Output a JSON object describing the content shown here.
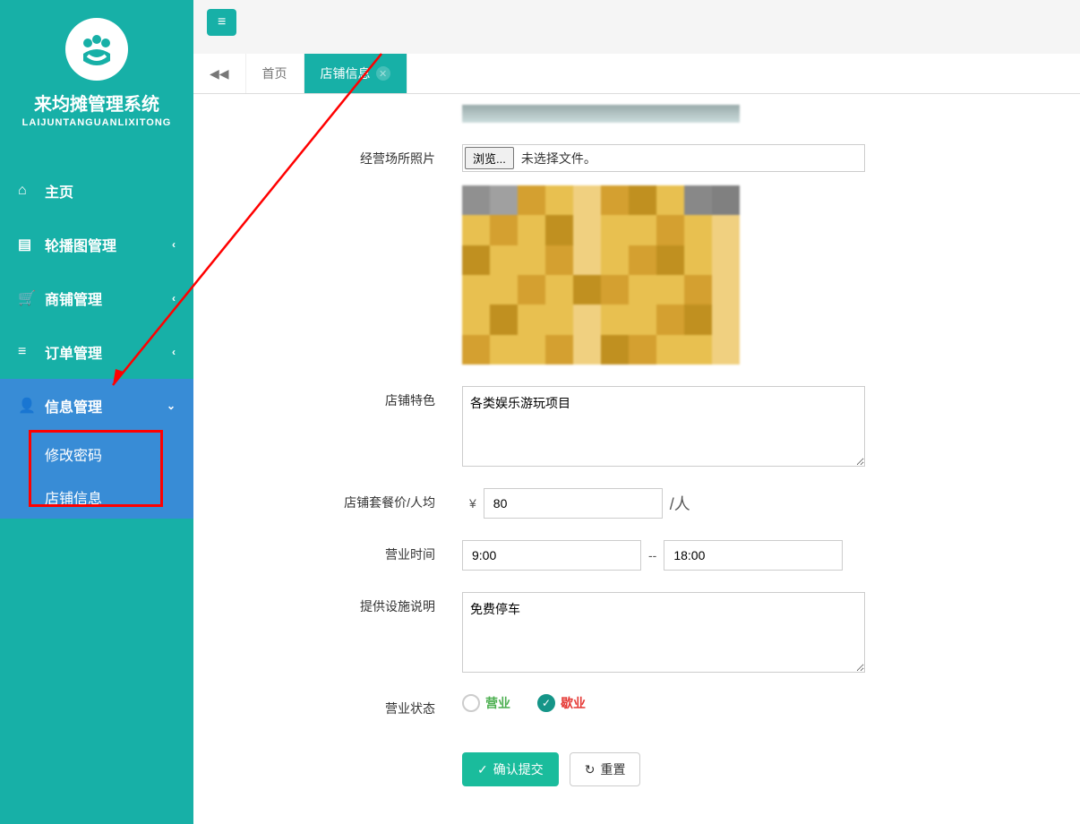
{
  "sidebar": {
    "system_name": "来均摊管理系统",
    "system_sub": "LAIJUNTANGUANLIXITONG",
    "items": [
      {
        "label": "主页",
        "expandable": false
      },
      {
        "label": "轮播图管理",
        "expandable": true
      },
      {
        "label": "商铺管理",
        "expandable": true
      },
      {
        "label": "订单管理",
        "expandable": true
      },
      {
        "label": "信息管理",
        "expandable": true,
        "expanded": true
      }
    ],
    "submenu": [
      {
        "label": "修改密码"
      },
      {
        "label": "店铺信息"
      }
    ]
  },
  "tabs": {
    "home": "首页",
    "active": "店铺信息"
  },
  "form": {
    "photo_label": "经营场所照片",
    "browse_button": "浏览...",
    "no_file": "未选择文件。",
    "feature_label": "店铺特色",
    "feature_value": "各类娱乐游玩项目",
    "price_label": "店铺套餐价/人均",
    "price_prefix": "¥",
    "price_value": "80",
    "price_suffix": "/人",
    "hours_label": "营业时间",
    "hours_start": "9:00",
    "hours_sep": "--",
    "hours_end": "18:00",
    "facility_label": "提供设施说明",
    "facility_value": "免费停车",
    "status_label": "营业状态",
    "status_open": "营业",
    "status_closed": "歇业",
    "submit": "确认提交",
    "reset": "重置"
  }
}
